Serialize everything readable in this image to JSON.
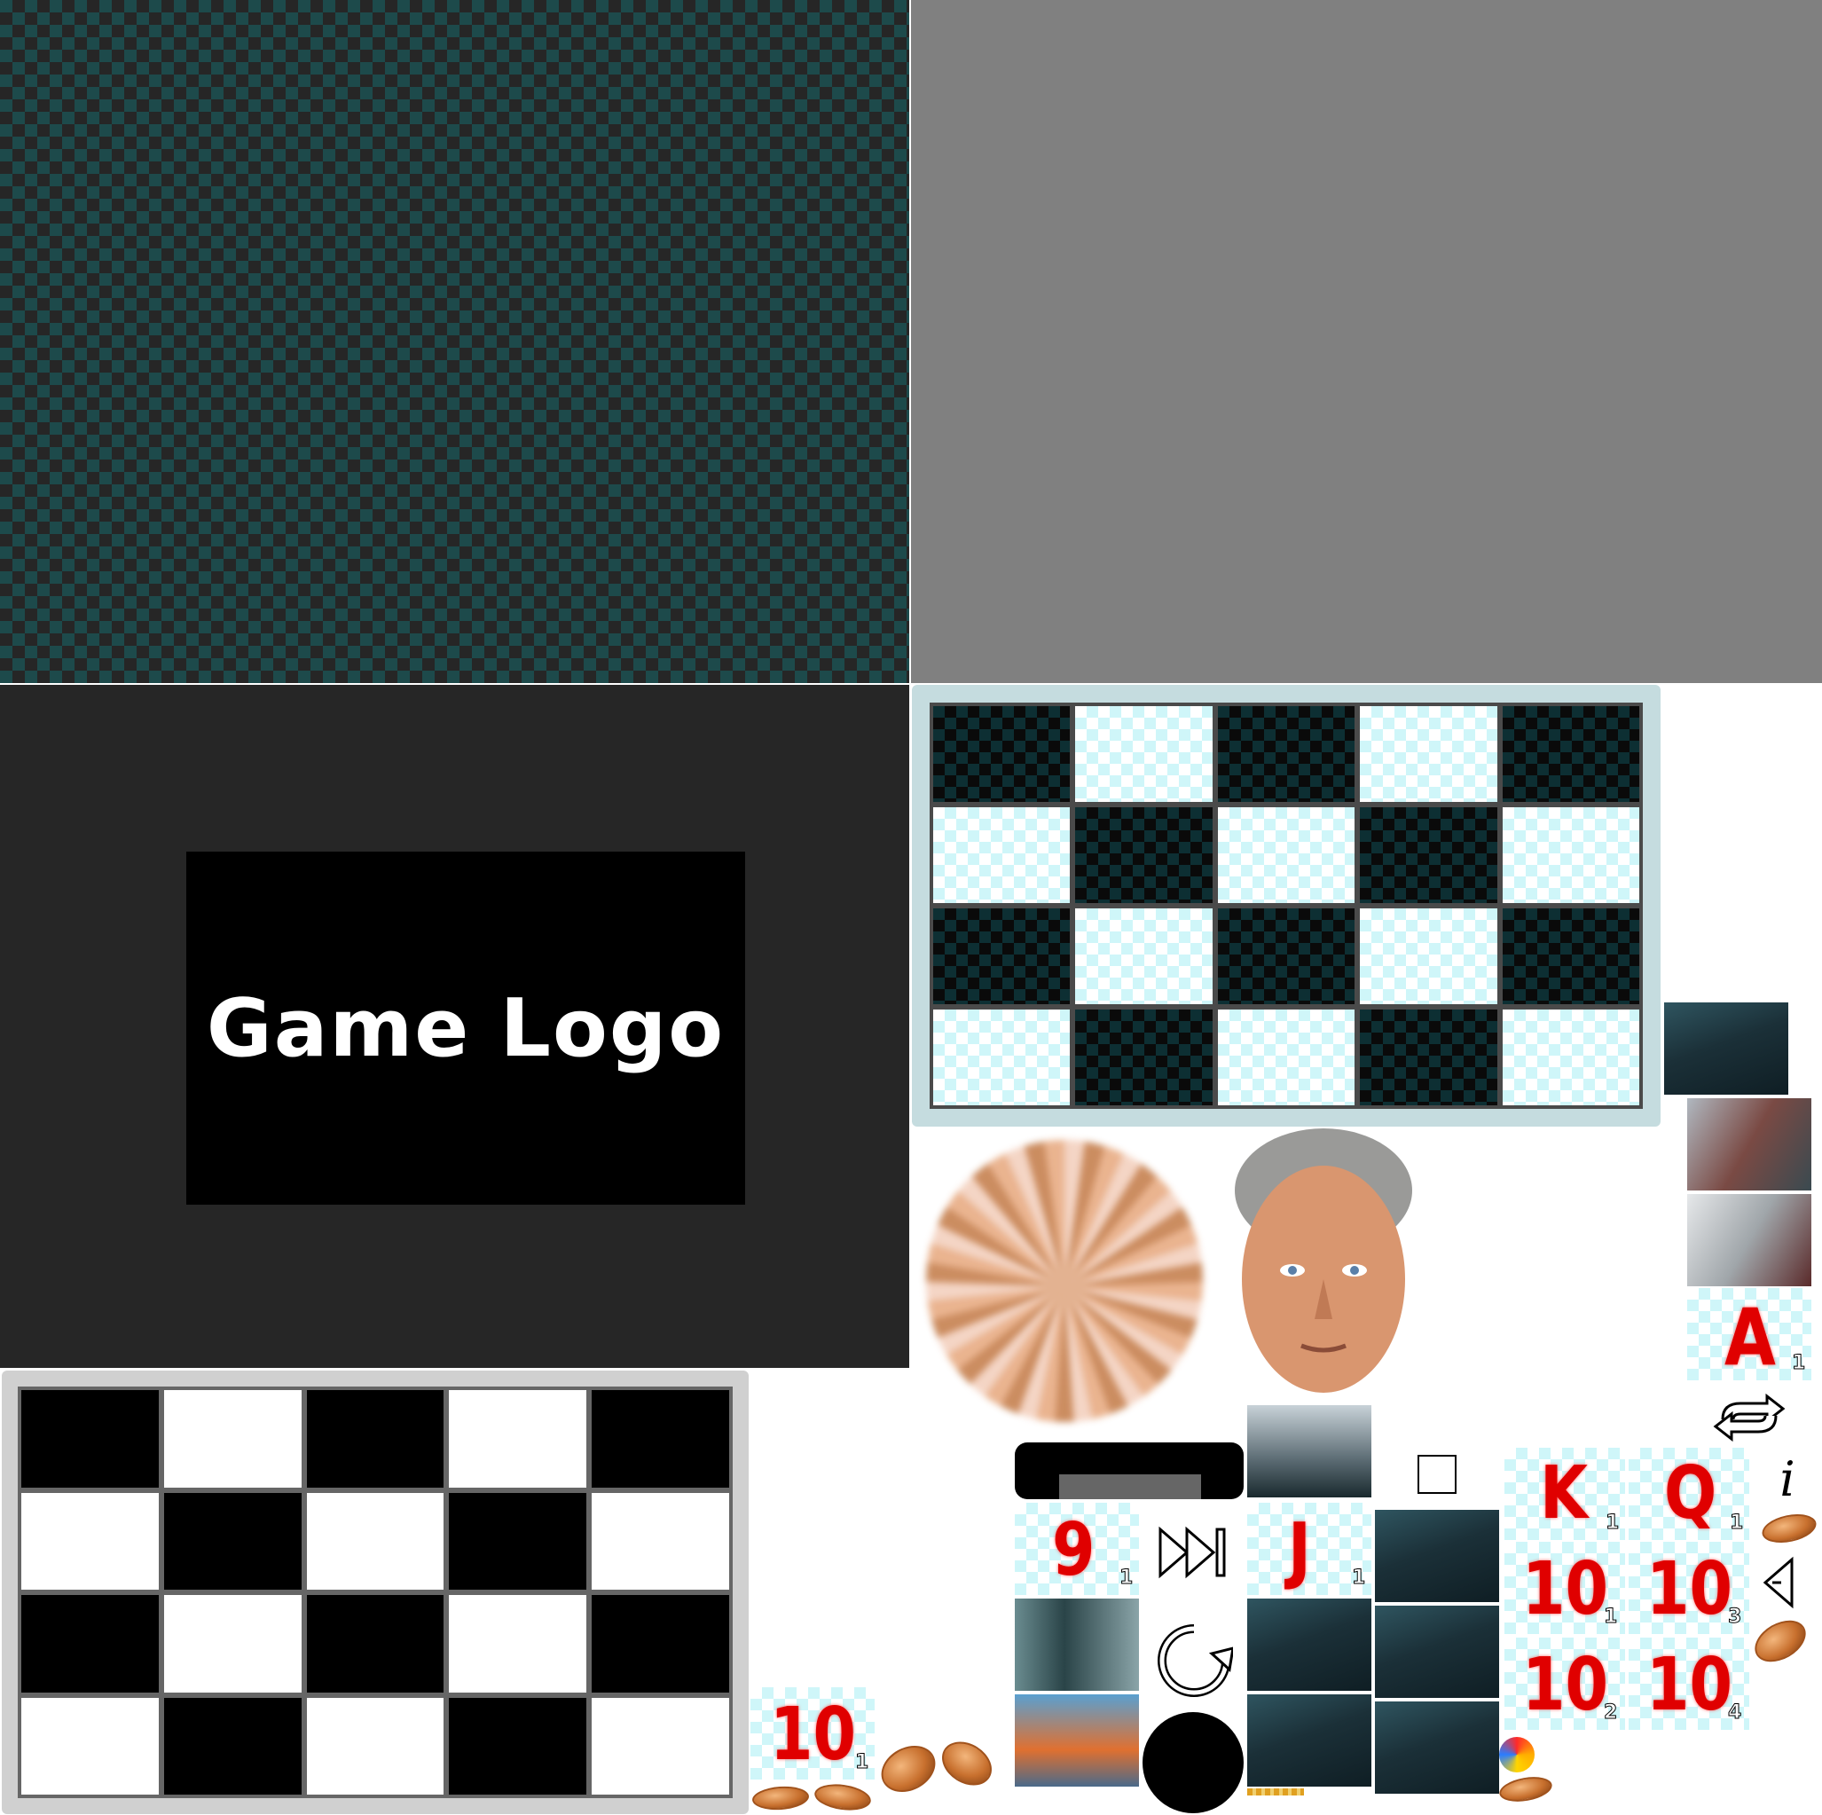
{
  "logo": {
    "text": "Game Logo"
  },
  "cards": {
    "A": "A",
    "K": "K",
    "Q": "Q",
    "J": "J",
    "nine": "9",
    "ten": "10",
    "idx1": "1",
    "idx2": "2",
    "idx3": "3",
    "idx4": "4"
  },
  "icons": [
    "loop-arrows-icon",
    "info-icon",
    "stop-square-icon",
    "fast-forward-icon",
    "back-triangle-icon",
    "reload-icon",
    "spin-button-icon",
    "coin-icon"
  ],
  "colors": {
    "teal": "#1d4a4b",
    "dark": "#262626",
    "gray": "#808080",
    "card_red": "#e00000",
    "check_light": "#cff6f9"
  }
}
